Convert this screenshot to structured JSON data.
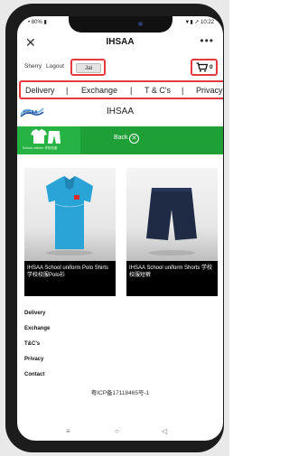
{
  "status": {
    "left": "• 80% ▮",
    "right": "▼▮ ↗ 10:22"
  },
  "nav": {
    "close": "✕",
    "title": "IHSAA",
    "more": "•••"
  },
  "user": {
    "name": "Sherry",
    "logout": "Logout",
    "language": "Jai",
    "cart_count": "0"
  },
  "menu": {
    "items": [
      "Delivery",
      "|",
      "Exchange",
      "|",
      "T & C's",
      "|",
      "Privacy"
    ]
  },
  "brand": {
    "logo_text": "IHSAA",
    "title": "IHSAA"
  },
  "banner": {
    "tile_label": "School uniform 学校校服",
    "back": "Back",
    "back_icon": "✕"
  },
  "products": [
    {
      "name": "IHSAA School uniform Polo Shirts 学校校服Polo衫",
      "image": "blue-polo-shirt"
    },
    {
      "name": "IHSAA School uniform Shorts 学校校服短裤",
      "image": "navy-shorts"
    }
  ],
  "footer": {
    "links": [
      "Delivery",
      "Exchange",
      "T&C's",
      "Privacy",
      "Contact"
    ],
    "icp": "粤ICP备17118465号-1"
  },
  "system_nav": {
    "menu": "≡",
    "home": "○",
    "back": "◁"
  },
  "colors": {
    "highlight": "#e8393f",
    "green": "#1ea036",
    "shirt": "#2aa3d6",
    "shorts": "#1f2a44"
  }
}
